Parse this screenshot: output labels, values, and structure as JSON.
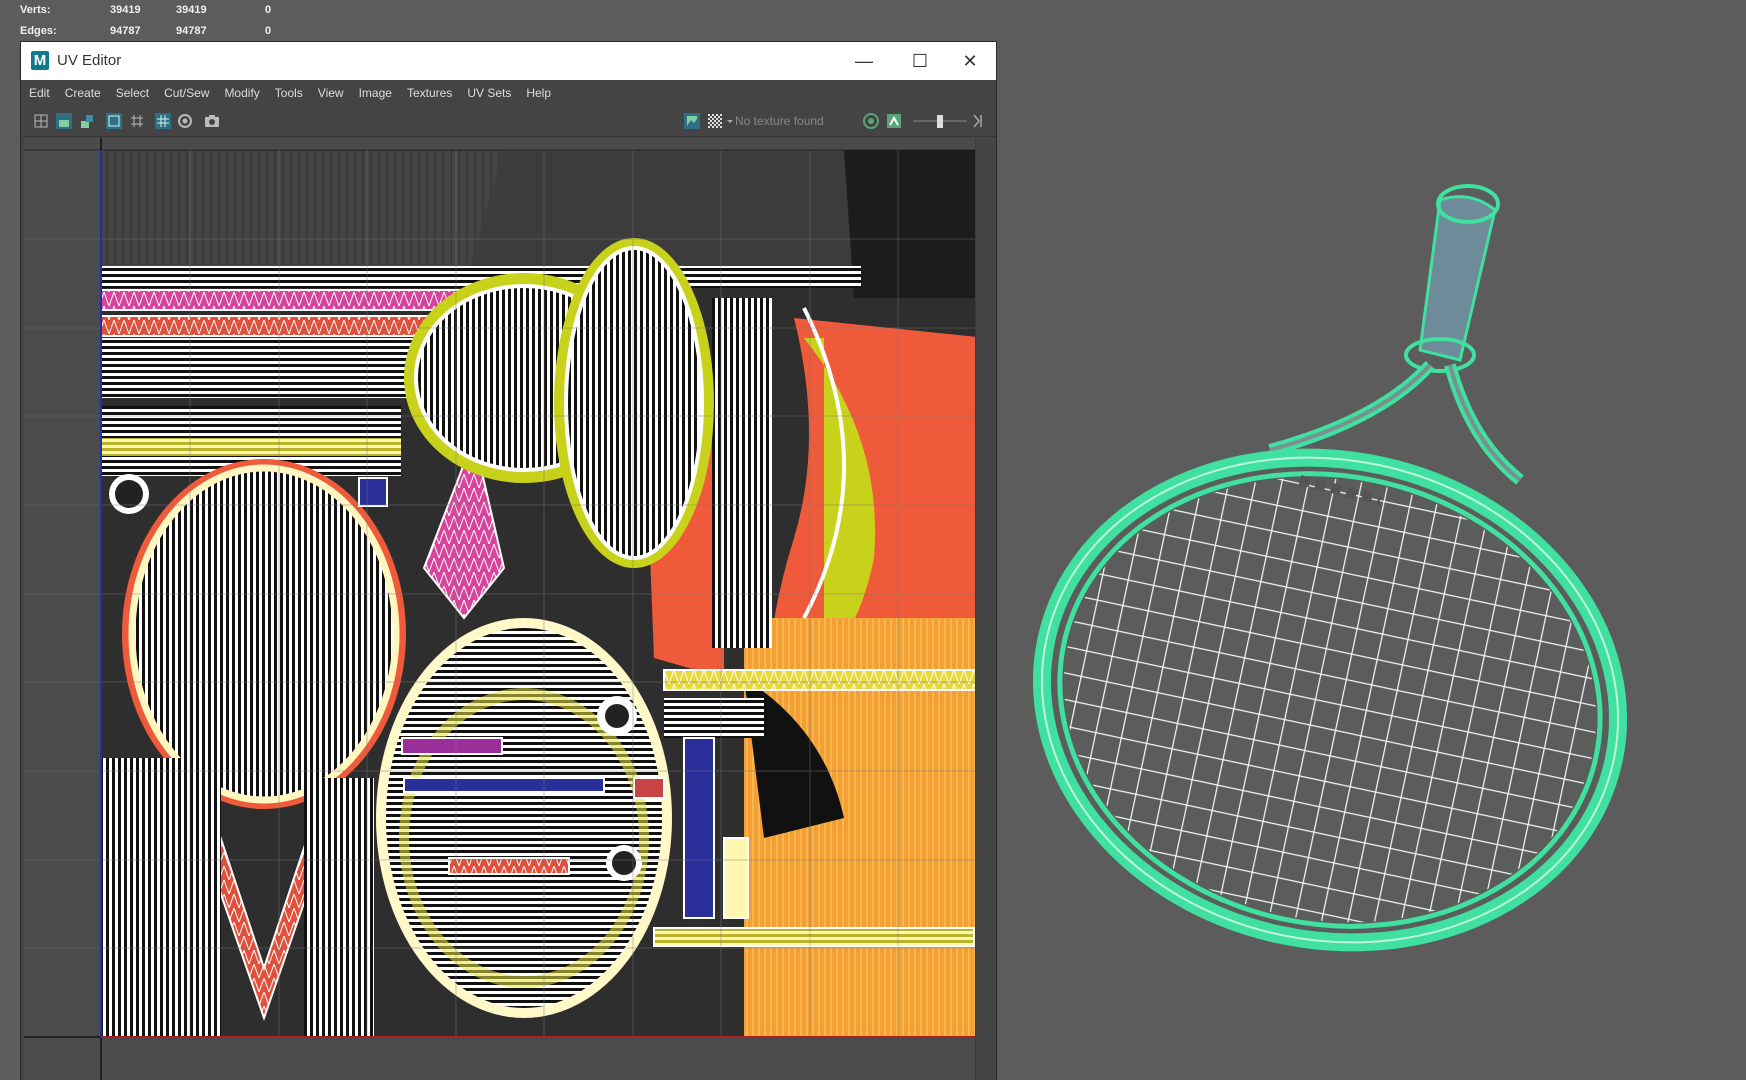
{
  "stats": {
    "rows": [
      {
        "label": "Verts:",
        "values": [
          "39419",
          "39419",
          "0"
        ]
      },
      {
        "label": "Edges:",
        "values": [
          "94787",
          "94787",
          "0"
        ]
      }
    ]
  },
  "uv_editor": {
    "title": "UV Editor",
    "logo": "M",
    "window_controls": {
      "minimize": "—",
      "maximize": "☐",
      "close": "✕"
    },
    "menu": [
      "Edit",
      "Create",
      "Select",
      "Cut/Sew",
      "Modify",
      "Tools",
      "View",
      "Image",
      "Textures",
      "UV Sets",
      "Help"
    ],
    "toolbar": {
      "left_icons": [
        "uv-shell-icon",
        "checker-shade-icon",
        "distortion-icon",
        "grid-toggle-icon",
        "pixel-snap-icon",
        "uv-grid-icon",
        "isolate-icon",
        "snapshot-icon"
      ],
      "right_icons": [
        "image-display-icon",
        "checker-icon",
        "dropdown-icon",
        "rgb-channel-icon",
        "alpha-icon",
        "exposure-slider",
        "gamma-icon"
      ],
      "texture_status": "No texture found"
    }
  },
  "colors": {
    "uv_wire": "#ffffff",
    "distortion_red": "#ef5a3a",
    "distortion_yellow": "#c8d21a",
    "orange": "#f08c2a",
    "mesh_highlight": "#3fe0a0"
  }
}
